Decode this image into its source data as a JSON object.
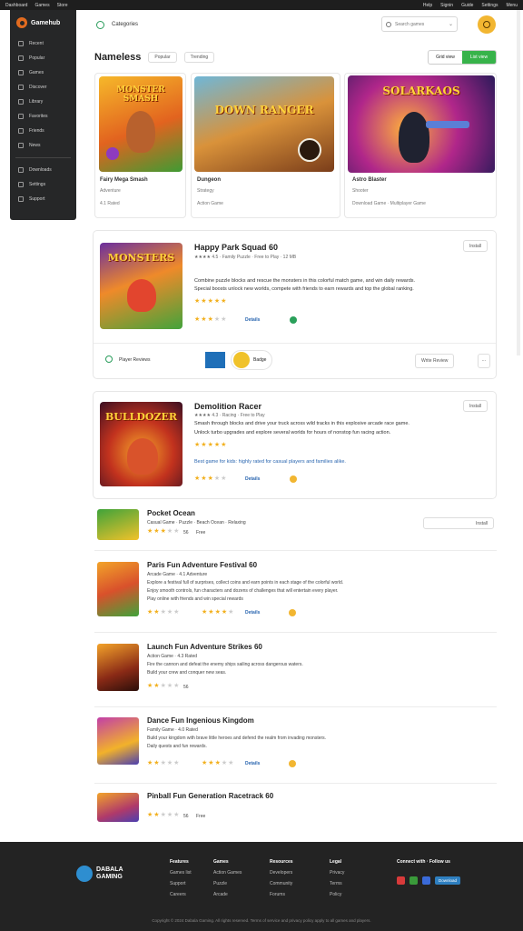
{
  "topbar": {
    "left": [
      "Dashboard",
      "Games",
      "Store"
    ],
    "right": [
      "Help",
      "Signin",
      "Guide",
      "Settings",
      "Menu"
    ]
  },
  "sidebar": {
    "brand": "Gamehub",
    "items": [
      "Recent",
      "Popular",
      "Games",
      "Discover",
      "Library",
      "Favorites",
      "Friends",
      "News",
      "Downloads",
      "Settings",
      "Support"
    ]
  },
  "header": {
    "title": "Categories",
    "search_placeholder": "Search games"
  },
  "page": {
    "title": "Nameless",
    "chip1": "Popular",
    "chip2": "Trending",
    "seg_left": "Grid view",
    "seg_right": "List view"
  },
  "top_cards": [
    {
      "art": "MONSTER SMASH",
      "title": "Fairy Mega Smash",
      "line1": "Adventure",
      "line2": "4.1 Rated"
    },
    {
      "art": "DOWN RANGER",
      "title": "Dungeon",
      "line1": "Strategy",
      "line2": "Action Game"
    },
    {
      "art": "SOLARKAOS",
      "title": "Astro Blaster",
      "line1": "Shooter",
      "line2": "Download Game · Multiplayer Game"
    }
  ],
  "feature1": {
    "art": "MONSTERS",
    "title": "Happy Park Squad 60",
    "meta": "★★★★ 4.5 · Family Puzzle · Free to Play · 12 MB",
    "desc1": "Combine puzzle blocks and rescue the monsters in this colorful match game, and win daily rewards.",
    "desc2": "Special boosts unlock new worlds, compete with friends to earn rewards and top the global ranking.",
    "rating_a": 5,
    "rating_b": 3,
    "link": "Details",
    "footer_label": "Player Reviews",
    "pill": "Badge",
    "btn": "Write Review",
    "btn_top": "Install"
  },
  "feature2": {
    "art": "BULLDOZER",
    "title": "Demolition Racer",
    "meta": "★★★★ 4.3 · Racing · Free to Play",
    "desc1": "Smash through blocks and drive your truck across wild tracks in this explosive arcade race game.",
    "desc2": "Unlock turbo upgrades and explore several worlds for hours of nonstop fun racing action.",
    "rating_a": 5,
    "rating_b": 3,
    "note": "Best game for kids: highly rated for casual players and families alike.",
    "link": "Details",
    "btn_top": "Install"
  },
  "rows": [
    {
      "art": "JUNGLE",
      "title": "Pocket Ocean",
      "line1": "Casual Game · Puzzle · Beach Ocean · Relaxing",
      "rating": 3,
      "count": "56",
      "extra": "Free",
      "btn": "Install"
    },
    {
      "art": "MONSTERS",
      "title": "Paris Fun Adventure Festival 60",
      "line1": "Arcade Game · 4.1 Adventure",
      "line2": "Explore a festival full of surprises, collect coins and earn points in each stage of the colorful world.",
      "line3": "Enjoy smooth controls, fun characters and dozens of challenges that will entertain every player.",
      "line4": "Play online with friends and win special rewards",
      "rating": 2,
      "rating_b": 4,
      "link": "Details"
    },
    {
      "art": "PIRATE",
      "title": "Launch Fun Adventure Strikes 60",
      "line1": "Action Game · 4.3 Rated",
      "line2": "Fire the cannon and defeat the enemy ships sailing across dangerous waters.",
      "line3": "Build your crew and conquer new seas.",
      "rating": 2,
      "count": "56"
    },
    {
      "art": "BUDDIES",
      "title": "Dance Fun Ingenious Kingdom",
      "line1": "Family Game · 4.0 Rated",
      "line2": "Build your kingdom with brave little heroes and defend the realm from invading monsters.",
      "line3": "Daily quests and fun rewards.",
      "rating": 2,
      "rating_b": 3,
      "link": "Details"
    },
    {
      "art": "SQUAD",
      "title": "Pinball Fun Generation Racetrack 60",
      "rating": 2,
      "count": "56",
      "extra": "Free"
    }
  ],
  "footer": {
    "brand1": "DABALA",
    "brand2": "GAMING",
    "cols": [
      {
        "h": "Features",
        "items": [
          "Games list",
          "Support",
          "Careers"
        ]
      },
      {
        "h": "Games",
        "items": [
          "Action Games",
          "Puzzle",
          "Arcade"
        ]
      },
      {
        "h": "Resources",
        "items": [
          "Developers",
          "Community",
          "Forums"
        ]
      },
      {
        "h": "Legal",
        "items": [
          "Privacy",
          "Terms",
          "Policy"
        ]
      }
    ],
    "social_h1": "Connect with",
    "social_h2": "Follow us",
    "app_btn": "Download",
    "copyright": "Copyright © 2024 Dabala Gaming. All rights reserved. Terms of service and privacy policy apply to all games and players."
  }
}
